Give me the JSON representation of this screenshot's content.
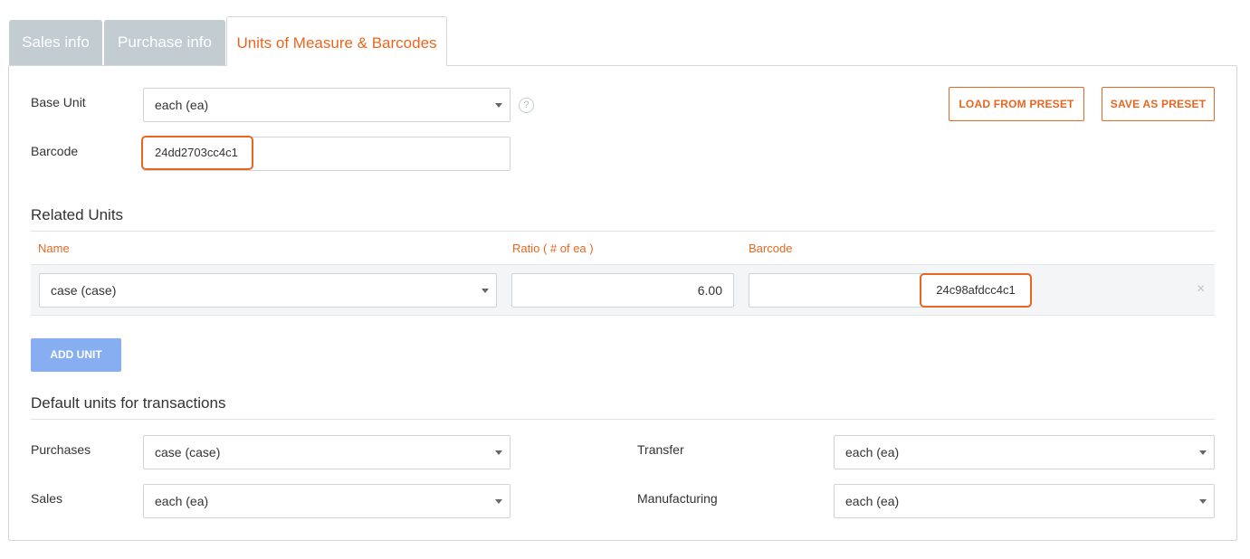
{
  "tabs": [
    {
      "label": "Sales info"
    },
    {
      "label": "Purchase info"
    },
    {
      "label": "Units of Measure & Barcodes"
    }
  ],
  "base_unit": {
    "label": "Base Unit",
    "value": "each (ea)",
    "help": "?"
  },
  "barcode": {
    "label": "Barcode",
    "value": "24dd2703cc4c1"
  },
  "actions": {
    "load_preset": "LOAD FROM PRESET",
    "save_preset": "SAVE AS PRESET"
  },
  "related_units": {
    "title": "Related Units",
    "columns": [
      "Name",
      "Ratio ( # of ea )",
      "Barcode"
    ],
    "rows": [
      {
        "name": "case (case)",
        "ratio": "6.00",
        "barcode": "24c98afdcc4c1",
        "remove": "×"
      }
    ],
    "add_button": "ADD UNIT"
  },
  "defaults": {
    "title": "Default units for transactions",
    "purchases": {
      "label": "Purchases",
      "value": "case (case)"
    },
    "sales": {
      "label": "Sales",
      "value": "each (ea)"
    },
    "transfer": {
      "label": "Transfer",
      "value": "each (ea)"
    },
    "manufacturing": {
      "label": "Manufacturing",
      "value": "each (ea)"
    }
  },
  "colors": {
    "accent": "#e8661f",
    "primary_button": "#86aef0",
    "tab_inactive": "#c3ccd1"
  }
}
